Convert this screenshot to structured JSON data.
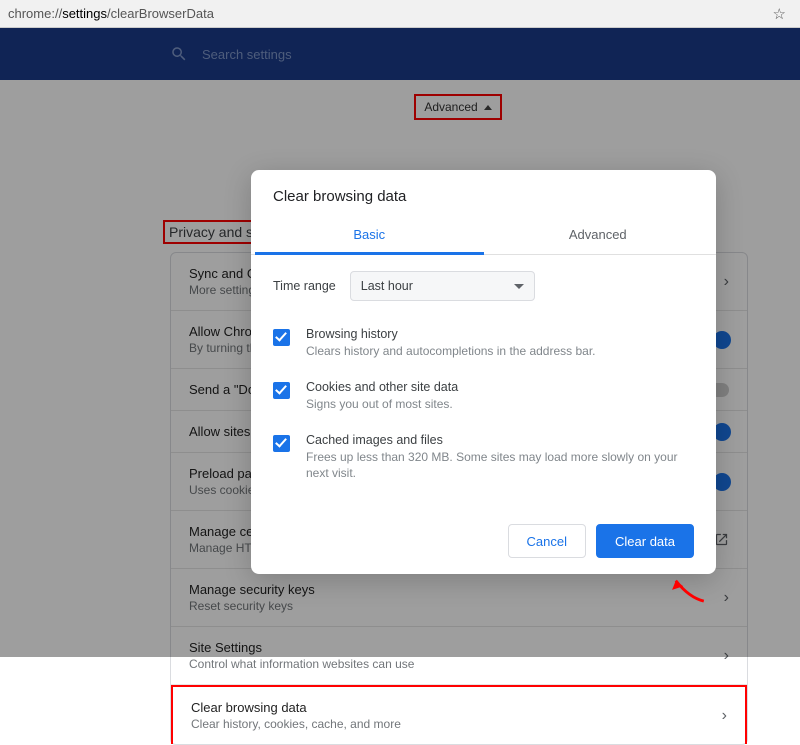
{
  "addressBar": {
    "prefix": "chrome://",
    "strong": "settings",
    "suffix": "/clearBrowserData"
  },
  "searchPlaceholder": "Search settings",
  "advancedLabel": "Advanced",
  "sectionTitle": "Privacy and security",
  "rows": [
    {
      "title": "Sync and Google services",
      "sub": "More settings",
      "type": "chev"
    },
    {
      "title": "Allow Chrome sign-in",
      "sub": "By turning this off...",
      "type": "toggle",
      "on": true
    },
    {
      "title": "Send a \"Do Not Track\" request",
      "sub": "",
      "type": "toggle",
      "on": false
    },
    {
      "title": "Allow sites to check if you have payment methods saved",
      "sub": "",
      "type": "toggle",
      "on": true
    },
    {
      "title": "Preload pages for faster browsing",
      "sub": "Uses cookies...",
      "type": "toggle",
      "on": true
    },
    {
      "title": "Manage certificates",
      "sub": "Manage HTTPS/SSL certificates",
      "type": "ext"
    },
    {
      "title": "Manage security keys",
      "sub": "Reset security keys",
      "type": "chev"
    },
    {
      "title": "Site Settings",
      "sub": "Control what information websites can use",
      "type": "chev"
    },
    {
      "title": "Clear browsing data",
      "sub": "Clear history, cookies, cache, and more",
      "type": "chev",
      "highlight": true
    }
  ],
  "modal": {
    "title": "Clear browsing data",
    "tabs": {
      "basic": "Basic",
      "advanced": "Advanced"
    },
    "timeRangeLabel": "Time range",
    "timeRangeValue": "Last hour",
    "options": [
      {
        "title": "Browsing history",
        "sub": "Clears history and autocompletions in the address bar."
      },
      {
        "title": "Cookies and other site data",
        "sub": "Signs you out of most sites."
      },
      {
        "title": "Cached images and files",
        "sub": "Frees up less than 320 MB. Some sites may load more slowly on your next visit."
      }
    ],
    "cancel": "Cancel",
    "clear": "Clear data"
  }
}
